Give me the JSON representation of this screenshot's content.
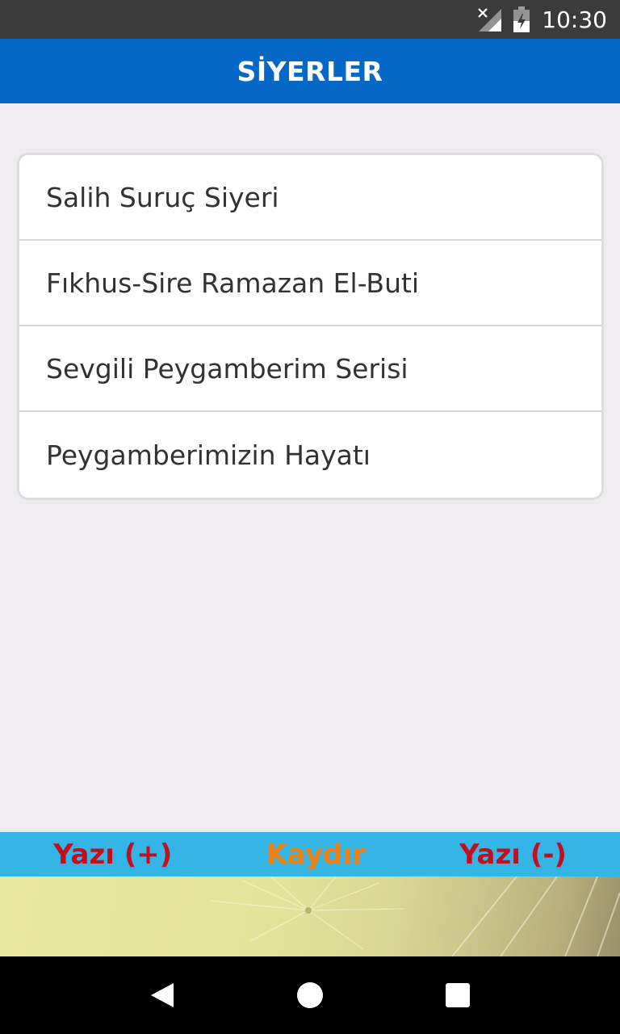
{
  "status_bar": {
    "time": "10:30",
    "icons": [
      "signal-no-service-icon",
      "battery-charging-icon"
    ]
  },
  "app_bar": {
    "title": "SİYERLER"
  },
  "list": {
    "items": [
      {
        "label": "Salih Suruç Siyeri"
      },
      {
        "label": "Fıkhus-Sire Ramazan El-Buti"
      },
      {
        "label": "Sevgili Peygamberim Serisi"
      },
      {
        "label": "Peygamberimizin Hayatı"
      }
    ]
  },
  "toolbar": {
    "font_increase_label": "Yazı (+)",
    "scroll_label": "Kaydır",
    "font_decrease_label": "Yazı (-)"
  },
  "nav_bar": {
    "icons": [
      "back-icon",
      "home-icon",
      "recents-icon"
    ]
  },
  "colors": {
    "app_bar": "#0568c6",
    "toolbar": "#33b5e5",
    "toolbar_red": "#c40e1e",
    "toolbar_orange": "#f27d0a",
    "background": "#eeecef"
  }
}
